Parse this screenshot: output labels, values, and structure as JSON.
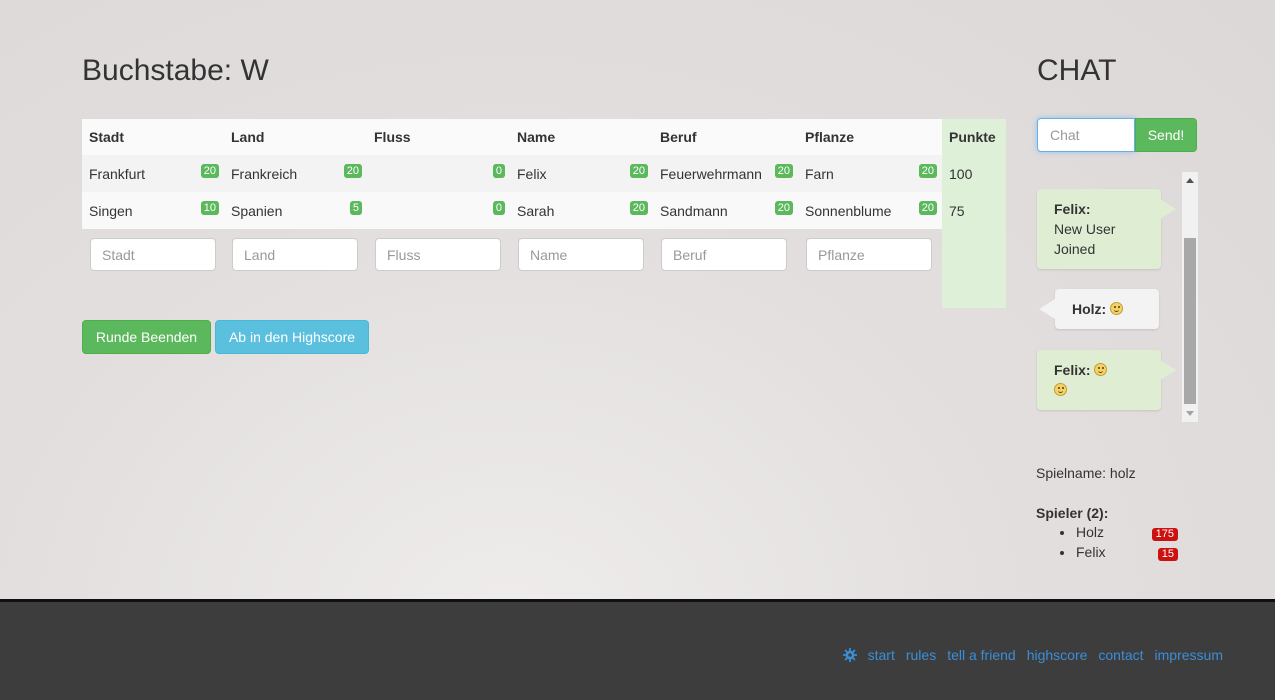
{
  "main": {
    "title": "Buchstabe: W",
    "headers": [
      "Stadt",
      "Land",
      "Fluss",
      "Name",
      "Beruf",
      "Pflanze",
      "Punkte"
    ],
    "rows": [
      {
        "cells": [
          {
            "value": "Frankfurt",
            "score": "20"
          },
          {
            "value": "Frankreich",
            "score": "20"
          },
          {
            "value": "",
            "score": "0"
          },
          {
            "value": "Felix",
            "score": "20"
          },
          {
            "value": "Feuerwehrmann",
            "score": "20"
          },
          {
            "value": "Farn",
            "score": "20"
          }
        ],
        "points": "100"
      },
      {
        "cells": [
          {
            "value": "Singen",
            "score": "10"
          },
          {
            "value": "Spanien",
            "score": "5"
          },
          {
            "value": "",
            "score": "0"
          },
          {
            "value": "Sarah",
            "score": "20"
          },
          {
            "value": "Sandmann",
            "score": "20"
          },
          {
            "value": "Sonnenblume",
            "score": "20"
          }
        ],
        "points": "75"
      }
    ],
    "input_placeholders": [
      "Stadt",
      "Land",
      "Fluss",
      "Name",
      "Beruf",
      "Pflanze"
    ],
    "buttons": {
      "end_round": "Runde Beenden",
      "highscore": "Ab in den Highscore"
    }
  },
  "chat": {
    "title": "CHAT",
    "input_placeholder": "Chat",
    "send_label": "Send!",
    "messages": [
      {
        "author": "Felix:",
        "text": "New User Joined"
      },
      {
        "author": "Holz:",
        "icon": "tongue-smiley-icon"
      },
      {
        "author": "Felix:",
        "icon": "smiley-icon"
      }
    ]
  },
  "game": {
    "spielname_label": "Spielname: holz",
    "players_label": "Spieler (2):",
    "players": [
      {
        "name": "Holz",
        "score": "175"
      },
      {
        "name": "Felix",
        "score": "15"
      }
    ]
  },
  "footer": {
    "icon": "gear-icon",
    "links": [
      "start",
      "rules",
      "tell a friend",
      "highscore",
      "contact",
      "impressum"
    ]
  },
  "colors": {
    "success": "#5cb85c",
    "info": "#5bc0de",
    "points_column": "#dff0d8",
    "player_badge": "#cc1111",
    "footer_bg": "#3d3d3d",
    "footer_link": "#3b8ed8"
  }
}
